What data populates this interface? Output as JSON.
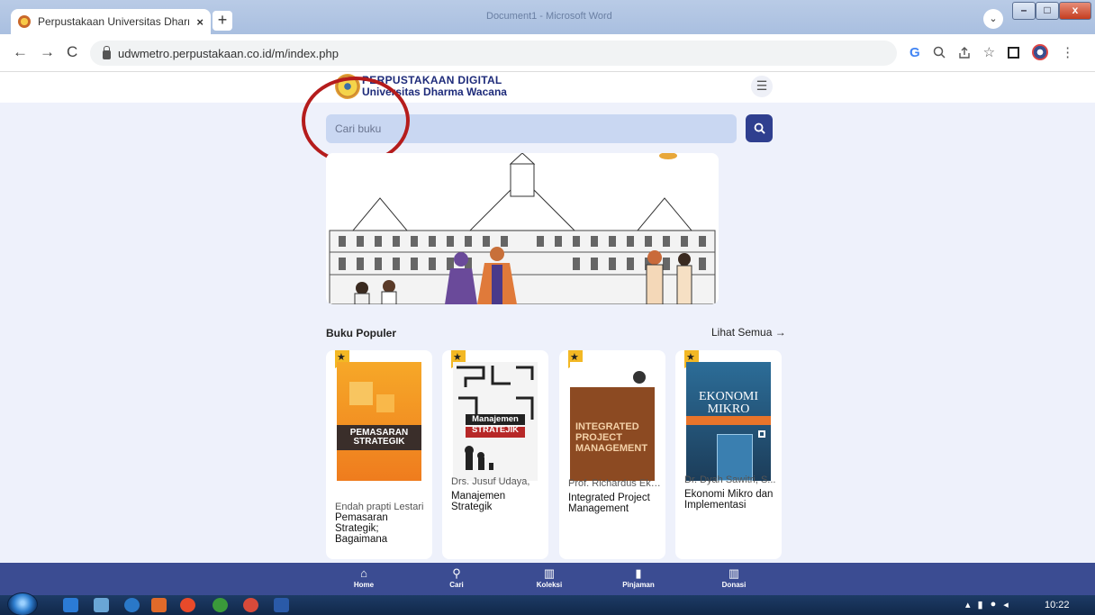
{
  "browser": {
    "tab_title": "Perpustakaan Universitas Dharma",
    "tab_close": "×",
    "new_tab": "+",
    "url": "udwmetro.perpustakaan.co.id/m/index.php",
    "background_doc_title": "Document1 - Microsoft Word"
  },
  "header": {
    "brand_line1": "PERPUSTAKAAN DIGITAL",
    "brand_line2": "Universitas Dharma Wacana"
  },
  "search": {
    "placeholder": "Cari buku"
  },
  "popular": {
    "title": "Buku Populer",
    "see_all": "Lihat Semua →",
    "books": [
      {
        "author": "Endah prapti Lestari",
        "title": "Pemasaran Strategik; Bagaimana",
        "cover_title": "PEMASARAN STRATEGIK"
      },
      {
        "author": "Drs. Jusuf Udaya,",
        "title": "Manajemen Strategik",
        "cover_title": "Manajemen STRATEJIK"
      },
      {
        "author": "Prof. Richardus Eko...",
        "title": "Integrated Project Management",
        "cover_title": "INTEGRATED PROJECT MANAGEMENT"
      },
      {
        "author": "Dr. Dyah Sawitri, S...",
        "title": "Ekonomi Mikro dan Implementasi",
        "cover_title": "EKONOMI MIKRO"
      }
    ]
  },
  "bottom_nav": [
    {
      "label": "Home",
      "icon": "home-icon"
    },
    {
      "label": "Cari",
      "icon": "search-icon"
    },
    {
      "label": "Koleksi",
      "icon": "book-open-icon"
    },
    {
      "label": "Pinjaman",
      "icon": "bookmark-icon"
    },
    {
      "label": "Donasi",
      "icon": "book-open-icon"
    }
  ],
  "taskbar": {
    "clock": "10:22"
  },
  "colors": {
    "primary": "#3b4c92",
    "search_bg": "#c9d7f2",
    "page_bg": "#eef1fb",
    "star": "#f3b824",
    "annotation": "#b51c1c"
  }
}
